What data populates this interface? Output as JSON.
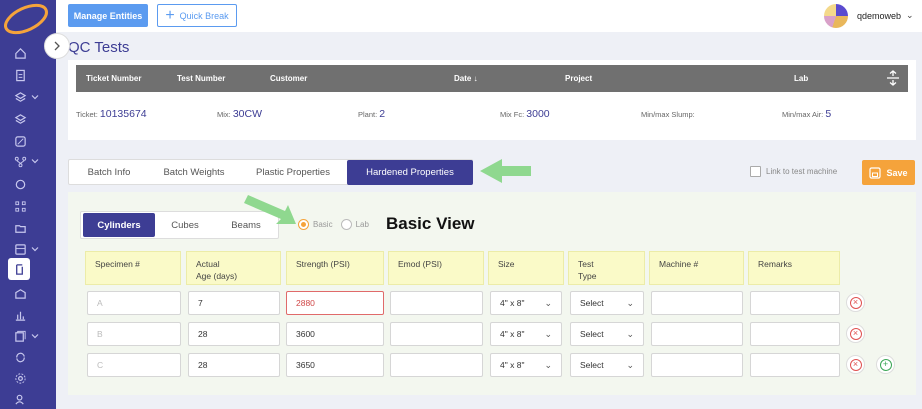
{
  "header": {
    "manage_entities": "Manage Entities",
    "quick_break": "Quick Break",
    "username": "qdemoweb"
  },
  "page": {
    "title": "QC Tests"
  },
  "ticket_table": {
    "columns": [
      "Ticket Number",
      "Test Number",
      "Customer",
      "Date ↓",
      "Project",
      "Lab"
    ],
    "fields": [
      {
        "label": "Ticket:",
        "value": "10135674"
      },
      {
        "label": "Mix:",
        "value": "30CW"
      },
      {
        "label": "Plant:",
        "value": "2"
      },
      {
        "label": "Mix Fc:",
        "value": "3000"
      },
      {
        "label": "Min/max Slump:",
        "value": ""
      },
      {
        "label": "Min/max Air:",
        "value": "5"
      }
    ]
  },
  "tabs": [
    "Batch Info",
    "Batch Weights",
    "Plastic Properties",
    "Hardened Properties"
  ],
  "active_tab": "Hardened Properties",
  "link_to_machine": "Link to test machine",
  "save": "Save",
  "sub_tabs": [
    "Cylinders",
    "Cubes",
    "Beams"
  ],
  "active_sub_tab": "Cylinders",
  "view_options": [
    "Basic",
    "Lab"
  ],
  "selected_view": "Basic",
  "annotation": "Basic View",
  "specimen_table": {
    "headers": [
      "Specimen #",
      "Actual\nAge (days)",
      "Strength (PSI)",
      "Emod (PSI)",
      "Size",
      "Test\nType",
      "Machine #",
      "Remarks"
    ],
    "rows": [
      {
        "specimen": "A",
        "age": "7",
        "strength": "2880",
        "emod": "",
        "size": "4\" x 8\"",
        "test_type": "Select",
        "machine": "",
        "remarks": ""
      },
      {
        "specimen": "B",
        "age": "28",
        "strength": "3600",
        "emod": "",
        "size": "4\" x 8\"",
        "test_type": "Select",
        "machine": "",
        "remarks": ""
      },
      {
        "specimen": "C",
        "age": "28",
        "strength": "3650",
        "emod": "",
        "size": "4\" x 8\"",
        "test_type": "Select",
        "machine": "",
        "remarks": ""
      }
    ]
  },
  "colors": {
    "sidebar": "#3d3d94",
    "accent_blue": "#5b9bf0",
    "save_orange": "#f5a33b",
    "header_yellow": "#fafac8",
    "annotation_arrow": "#8fd88f",
    "error_red": "#e05252"
  },
  "sidebar_icons": [
    "home-icon",
    "document-icon",
    "layers-icon",
    "stack-icon",
    "chart-icon",
    "flow-icon",
    "refresh-icon",
    "network-icon",
    "folder-icon",
    "inbox-icon",
    "cylinder-icon",
    "building-icon",
    "bar-chart-icon",
    "docs-icon",
    "sync-icon",
    "gear-icon",
    "users-icon"
  ]
}
